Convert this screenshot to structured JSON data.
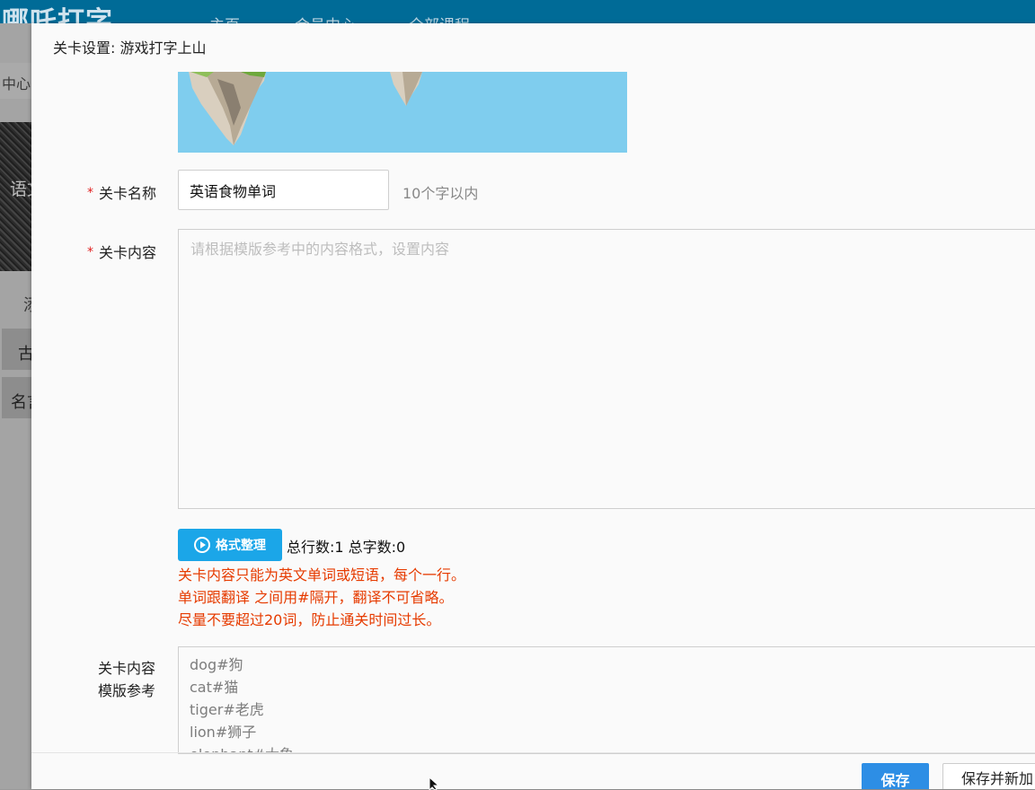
{
  "background": {
    "logo": "哪吒打字",
    "nav": [
      "主页",
      "会员中心",
      "全部课程"
    ],
    "breadcrumb": "中心",
    "banner_text": "语文",
    "side_items": [
      "添",
      "古",
      "名言"
    ]
  },
  "modal": {
    "title": "关卡设置: 游戏打字上山"
  },
  "form": {
    "name_label": "关卡名称",
    "name_value": "英语食物单词",
    "name_hint": "10个字以内",
    "content_label": "关卡内容",
    "content_placeholder": "请根据模版参考中的内容格式，设置内容",
    "format_button": "格式整理",
    "stats": "总行数:1 总字数:0",
    "rules": [
      "关卡内容只能为英文单词或短语，每个一行。",
      "单词跟翻译 之间用#隔开，翻译不可省略。",
      "尽量不要超过20词，防止通关时间过长。"
    ],
    "template_label_line1": "关卡内容",
    "template_label_line2": "模版参考",
    "template_lines": [
      "dog#狗",
      "cat#猫",
      "tiger#老虎",
      "lion#狮子",
      "elephant#大象"
    ],
    "required_mark": "*"
  },
  "footer": {
    "save_label": "保存",
    "save_new_label": "保存并新加"
  },
  "colors": {
    "header_bg": "#006b97",
    "primary_button": "#2d8ee5",
    "format_button": "#1ba6e8",
    "rule_text": "#e63b00",
    "required": "#e02020",
    "preview_sky": "#7fcdee"
  }
}
